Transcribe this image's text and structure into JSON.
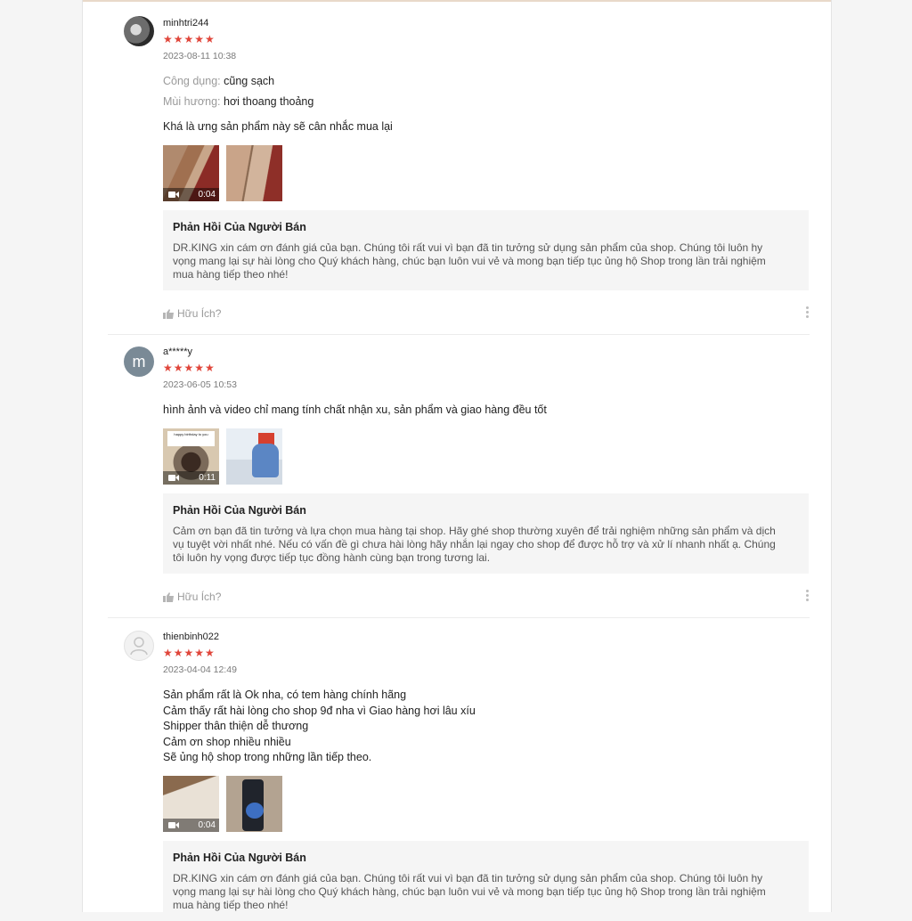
{
  "reviews": [
    {
      "username": "minhtri244",
      "stars": "★★★★★",
      "datetime": "2023-08-11 10:38",
      "attributes": [
        {
          "key": "Công dụng:",
          "value": "cũng sạch"
        },
        {
          "key": "Mùi hương:",
          "value": "hơi thoang thoảng"
        }
      ],
      "comment_lines": [
        "Khá là ưng sản phẩm này sẽ cân nhắc mua lại"
      ],
      "media": [
        {
          "type": "video",
          "duration": "0:04"
        },
        {
          "type": "image"
        }
      ],
      "reply_title": "Phản Hồi Của Người Bán",
      "reply_lines": [
        "DR.KING xin cám ơn đánh giá của bạn. Chúng tôi rất vui vì bạn đã tin tưởng sử dụng sản phẩm của shop. Chúng tôi luôn hy",
        "vọng mang lại sự hài lòng cho Quý khách hàng, chúc bạn luôn vui vẻ và mong bạn tiếp tục ủng hộ Shop trong lần trải nghiệm",
        "mua hàng tiếp theo nhé!"
      ],
      "helpful_label": "Hữu Ích?"
    },
    {
      "username": "a*****y",
      "avatar_letter": "m",
      "stars": "★★★★★",
      "datetime": "2023-06-05 10:53",
      "comment_lines": [
        "hình ảnh và video chỉ mang tính chất nhận xu, sản phẩm và giao hàng đều tốt"
      ],
      "media": [
        {
          "type": "video",
          "duration": "0:11"
        },
        {
          "type": "image"
        }
      ],
      "reply_title": "Phản Hồi Của Người Bán",
      "reply_lines": [
        "Cảm ơn bạn đã tin tưởng và lựa chọn mua hàng tại shop. Hãy ghé shop thường xuyên để trải nghiệm những sản phẩm và dịch",
        "vụ tuyệt vời nhất nhé. Nếu có vấn đề gì chưa hài lòng hãy nhắn lại ngay cho shop để được hỗ trợ và xử lí nhanh nhất ạ. Chúng",
        "tôi luôn hy vọng được tiếp tục đồng hành cùng bạn trong tương lai."
      ],
      "helpful_label": "Hữu Ích?"
    },
    {
      "username": "thienbinh022",
      "stars": "★★★★★",
      "datetime": "2023-04-04 12:49",
      "comment_lines": [
        "Sản phẩm rất là Ok nha, có tem hàng chính hãng",
        "Cảm thấy rất hài lòng cho shop 9đ nha vì Giao hàng hơi lâu xíu",
        "Shipper thân thiện dễ thương",
        "Cảm ơn shop nhiều nhiều",
        "Sẽ ủng hộ shop trong những lần tiếp theo."
      ],
      "media": [
        {
          "type": "video",
          "duration": "0:04"
        },
        {
          "type": "image"
        }
      ],
      "reply_title": "Phản Hồi Của Người Bán",
      "reply_lines": [
        "DR.KING xin cám ơn đánh giá của bạn. Chúng tôi rất vui vì bạn đã tin tưởng sử dụng sản phẩm của shop. Chúng tôi luôn hy",
        "vọng mang lại sự hài lòng cho Quý khách hàng, chúc bạn luôn vui vẻ và mong bạn tiếp tục ủng hộ Shop trong lần trải nghiệm",
        "mua hàng tiếp theo nhé!"
      ]
    }
  ],
  "thumb_caption": "happy birthday to you",
  "colors": {
    "star": "#e0453a",
    "reply_bg": "#f5f5f5",
    "muted": "#9a9a9a"
  }
}
